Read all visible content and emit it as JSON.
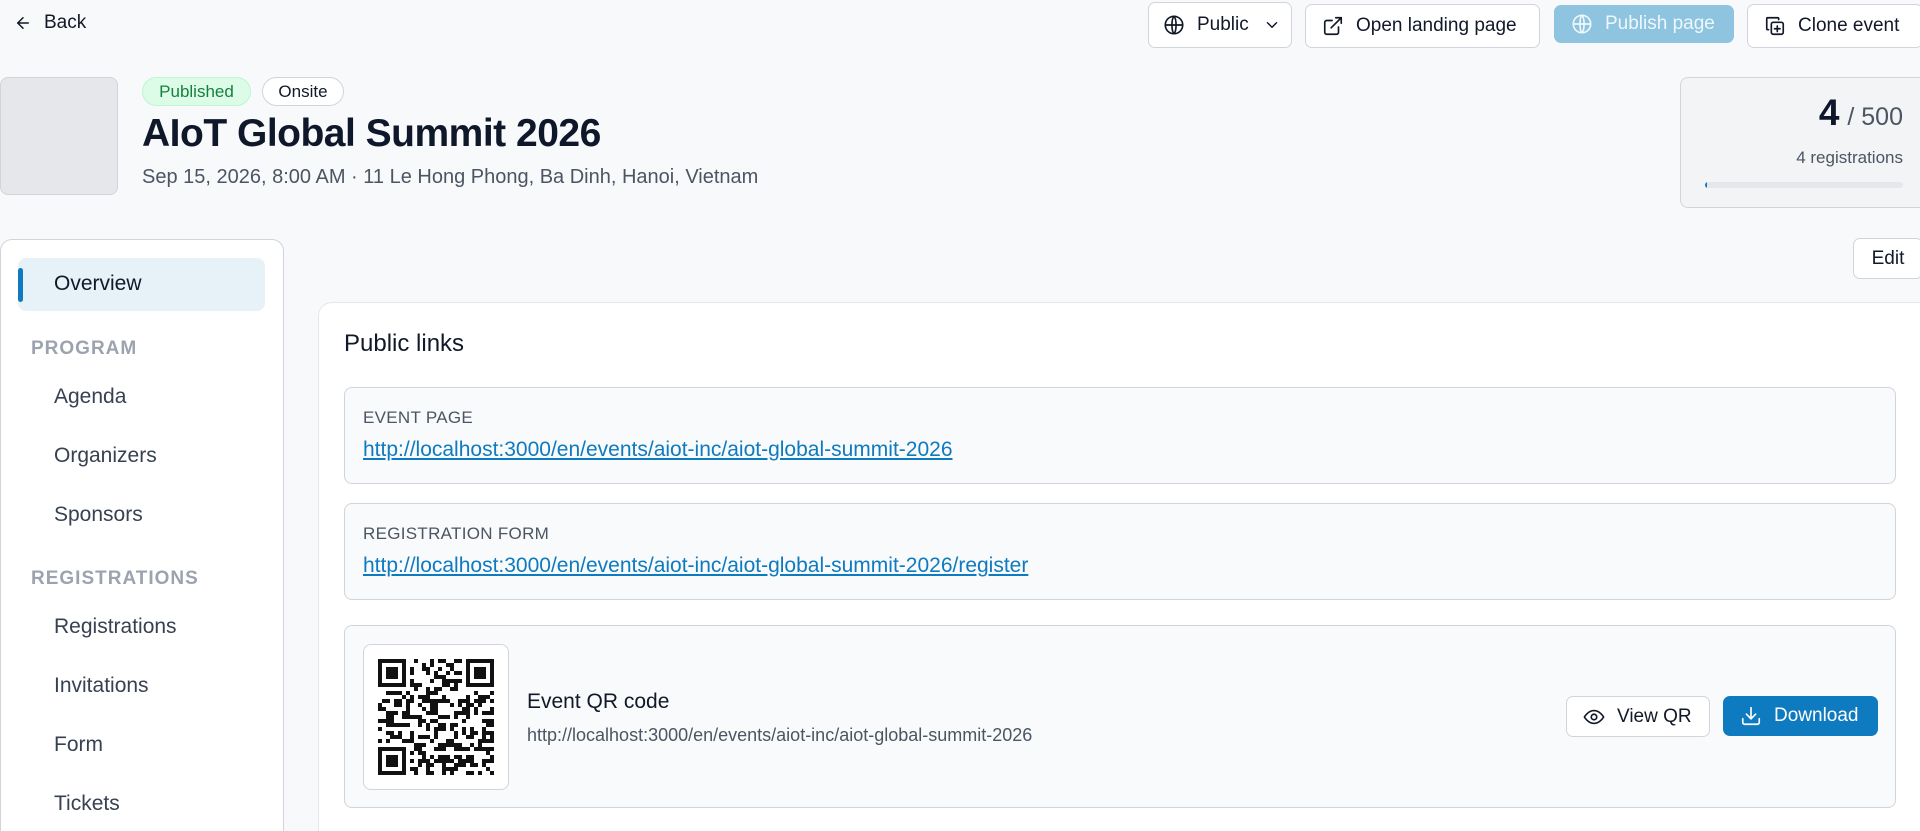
{
  "topbar": {
    "back_label": "Back",
    "visibility_label": "Public",
    "open_landing_label": "Open landing page",
    "publish_label": "Publish page",
    "clone_label": "Clone event"
  },
  "event": {
    "status_badge": "Published",
    "format_badge": "Onsite",
    "title": "AIoT Global Summit 2026",
    "subtitle": "Sep 15, 2026, 8:00 AM · 11 Le Hong Phong, Ba Dinh, Hanoi, Vietnam"
  },
  "capacity": {
    "count": "4",
    "total": "/ 500",
    "label": "4 registrations",
    "fill_fraction": 0.008
  },
  "sidebar": {
    "overview": "Overview",
    "sections": [
      {
        "title": "PROGRAM",
        "items": [
          "Agenda",
          "Organizers",
          "Sponsors"
        ]
      },
      {
        "title": "REGISTRATIONS",
        "items": [
          "Registrations",
          "Invitations",
          "Form",
          "Tickets"
        ]
      }
    ]
  },
  "main": {
    "edit_label": "Edit",
    "panel_title": "Public links",
    "event_page": {
      "label": "EVENT PAGE",
      "url": "http://localhost:3000/en/events/aiot-inc/aiot-global-summit-2026"
    },
    "registration_form": {
      "label": "REGISTRATION FORM",
      "url": "http://localhost:3000/en/events/aiot-inc/aiot-global-summit-2026/register"
    },
    "qr": {
      "title": "Event QR code",
      "url": "http://localhost:3000/en/events/aiot-inc/aiot-global-summit-2026",
      "view_label": "View QR",
      "download_label": "Download"
    }
  },
  "colors": {
    "accent": "#0e7abf",
    "publish_disabled": "#8ec4df",
    "badge_green_bg": "#dcfce7",
    "badge_green_text": "#15803d"
  },
  "icons": [
    "arrow-left-icon",
    "globe-icon",
    "chevron-down-icon",
    "external-link-icon",
    "copy-icon",
    "eye-icon",
    "download-icon",
    "qr-code-icon"
  ]
}
